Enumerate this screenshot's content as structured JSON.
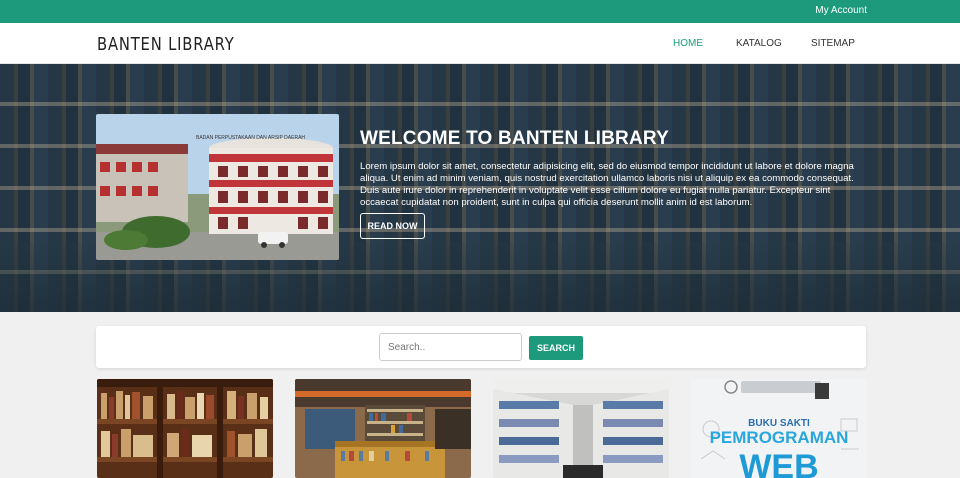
{
  "topbar": {
    "account_label": "My Account"
  },
  "navbar": {
    "brand": "BANTEN LIBRARY",
    "items": [
      {
        "label": "HOME",
        "active": true
      },
      {
        "label": "KATALOG",
        "active": false
      },
      {
        "label": "SITEMAP",
        "active": false
      }
    ]
  },
  "hero": {
    "title": "WELCOME TO BANTEN LIBRARY",
    "text": "Lorem ipsum dolor sit amet, consectetur adipisicing elit, sed do eiusmod tempor incididunt ut labore et dolore magna aliqua. Ut enim ad minim veniam, quis nostrud exercitation ullamco laboris nisi ut aliquip ex ea commodo consequat. Duis aute irure dolor in reprehenderit in voluptate velit esse cillum dolore eu fugiat nulla pariatur. Excepteur sint occaecat cupidatat non proident, sunt in culpa qui officia deserunt mollit anim id est laborum.",
    "button_label": "READ NOW",
    "photo_sign": "BADAN PERPUSTAKAAN DAN ARSIP DAERAH"
  },
  "search": {
    "placeholder": "Search..",
    "button_label": "SEARCH"
  },
  "cards": [
    {
      "name": "bookshelf-wood"
    },
    {
      "name": "library-room"
    },
    {
      "name": "library-aisle"
    },
    {
      "name": "book-cover",
      "cover_line1": "BUKU SAKTI",
      "cover_line2": "PEMROGRAMAN",
      "cover_line3": "WEB"
    }
  ],
  "colors": {
    "accent": "#1c9a7b",
    "brand_text": "#222222",
    "nav_text": "#333333"
  }
}
